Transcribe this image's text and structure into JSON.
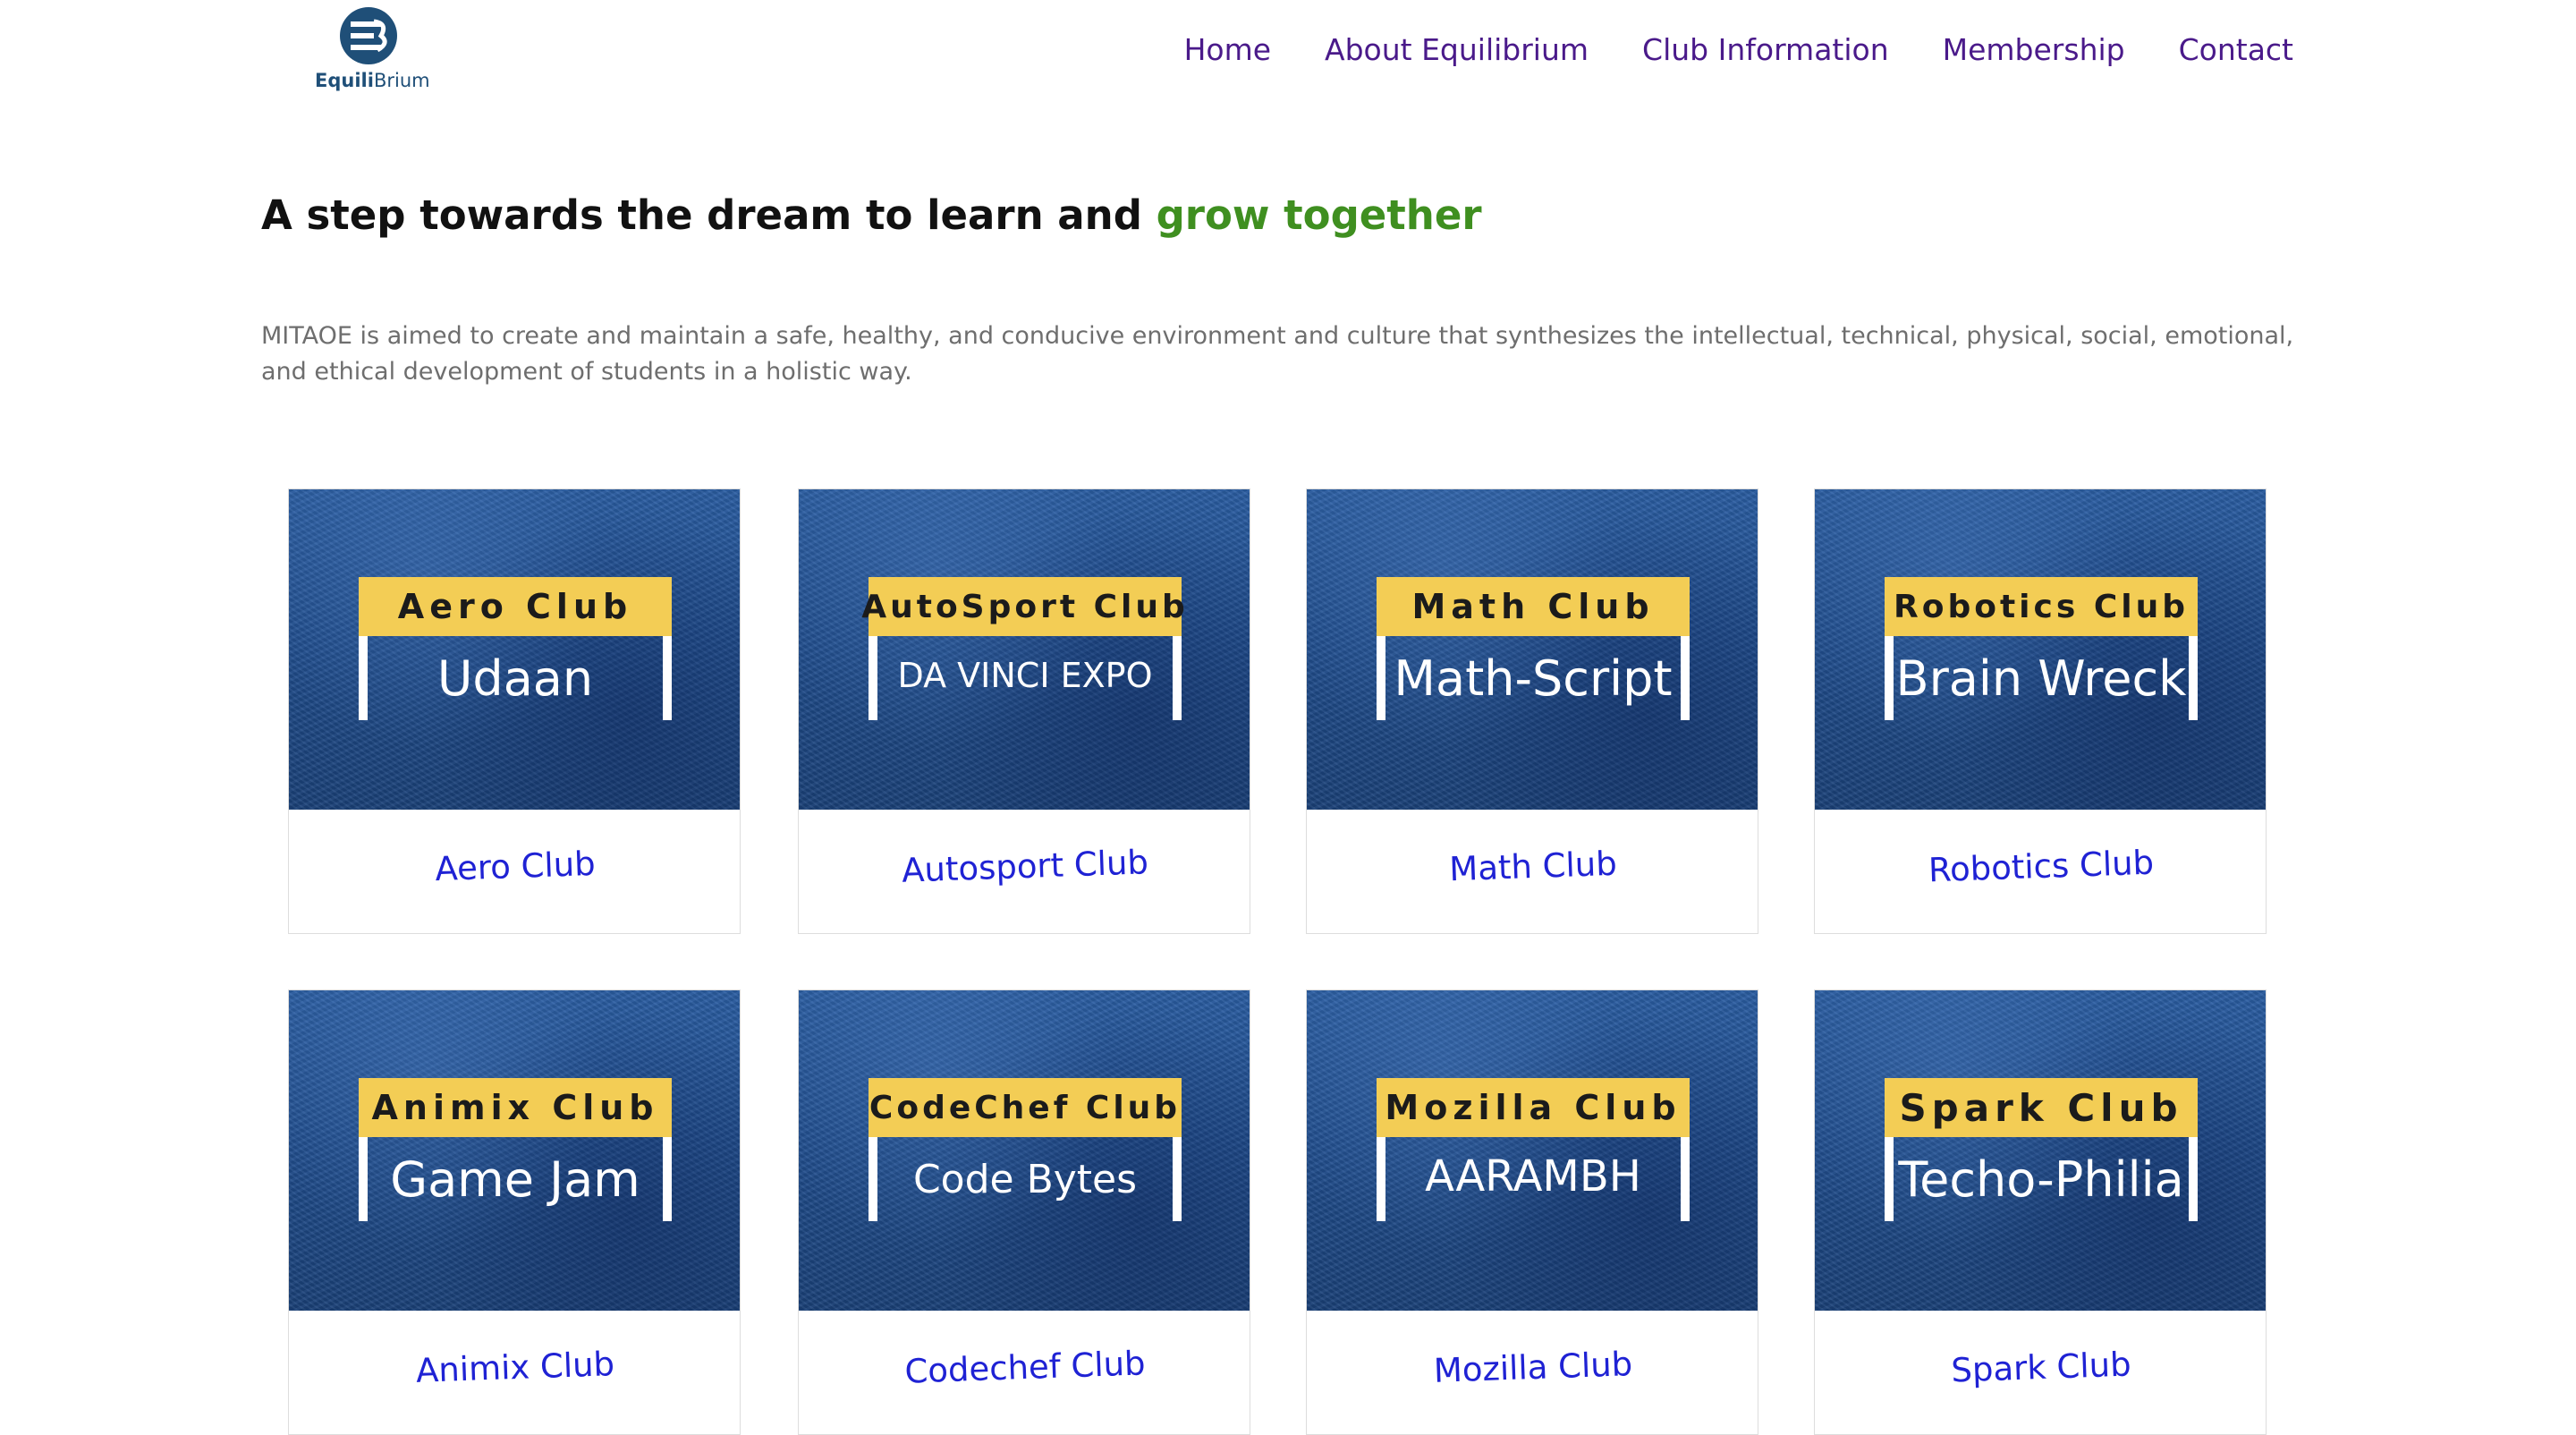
{
  "brand": {
    "logo_bold": "Equili",
    "logo_rest": "Brium"
  },
  "nav": {
    "items": [
      {
        "label": "Home"
      },
      {
        "label": "About Equilibrium"
      },
      {
        "label": "Club Information"
      },
      {
        "label": "Membership"
      },
      {
        "label": "Contact"
      }
    ]
  },
  "hero": {
    "headline_main": "A step towards the dream to learn and ",
    "headline_accent": "grow together",
    "intro": "MITAOE is aimed to create and maintain a safe, healthy, and conducive environment and culture that synthesizes the intellectual, technical, physical, social, emotional, and ethical development of students in a holistic way."
  },
  "clubs": [
    {
      "sign_title": "Aero Club",
      "sign_event": "Udaan",
      "name": "Aero Club"
    },
    {
      "sign_title": "AutoSport Club",
      "sign_event": "DA VINCI EXPO",
      "name": "Autosport Club"
    },
    {
      "sign_title": "Math Club",
      "sign_event": "Math-Script",
      "name": "Math Club"
    },
    {
      "sign_title": "Robotics Club",
      "sign_event": "Brain Wreck",
      "name": "Robotics Club"
    },
    {
      "sign_title": "Animix Club",
      "sign_event": "Game Jam",
      "name": "Animix Club"
    },
    {
      "sign_title": "CodeChef Club",
      "sign_event": "Code Bytes",
      "name": "Codechef Club"
    },
    {
      "sign_title": "Mozilla Club",
      "sign_event": "AARAMBH",
      "name": "Mozilla Club"
    },
    {
      "sign_title": "Spark Club",
      "sign_event": "Techo-Philia",
      "name": "Spark Club"
    }
  ],
  "colors": {
    "nav_text": "#4a1a8a",
    "accent_green": "#3f8f20",
    "card_link": "#1f22d4",
    "sign_yellow": "#f3cd55",
    "card_blue": "#1f4c8c",
    "logo_blue": "#1f4f78"
  },
  "icons": {
    "logo": "equilibrium-logo-icon"
  }
}
